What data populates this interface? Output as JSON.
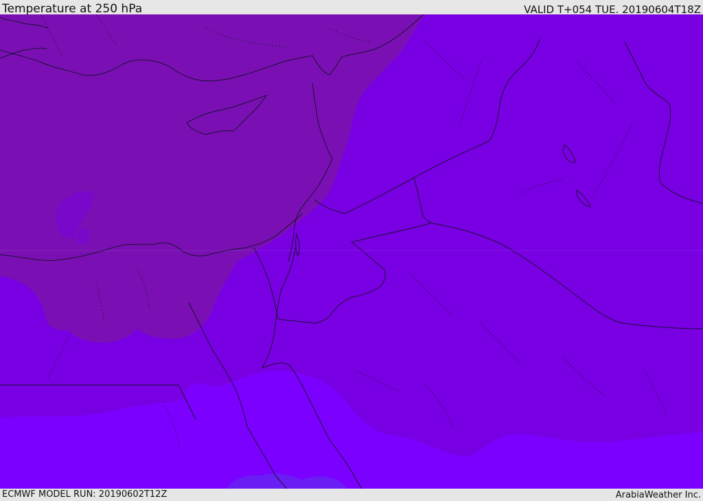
{
  "header": {
    "title": "Temperature at 250 hPa",
    "valid": "VALID T+054 TUE. 20190604T18Z"
  },
  "footer": {
    "model_run": "ECMWF MODEL RUN: 20190602T12Z",
    "credit": "ArabiaWeather Inc."
  },
  "map": {
    "field": "temperature",
    "pressure_level": "250 hPa",
    "colors": {
      "band_coldest": "#7a10b4",
      "band_cold": "#7a00e4",
      "band_mid": "#7c00f0",
      "band_warm": "#7c00ff",
      "band_warmest": "#6a1ef4",
      "coastline": "#1a1030",
      "border": "#1a1030"
    }
  }
}
